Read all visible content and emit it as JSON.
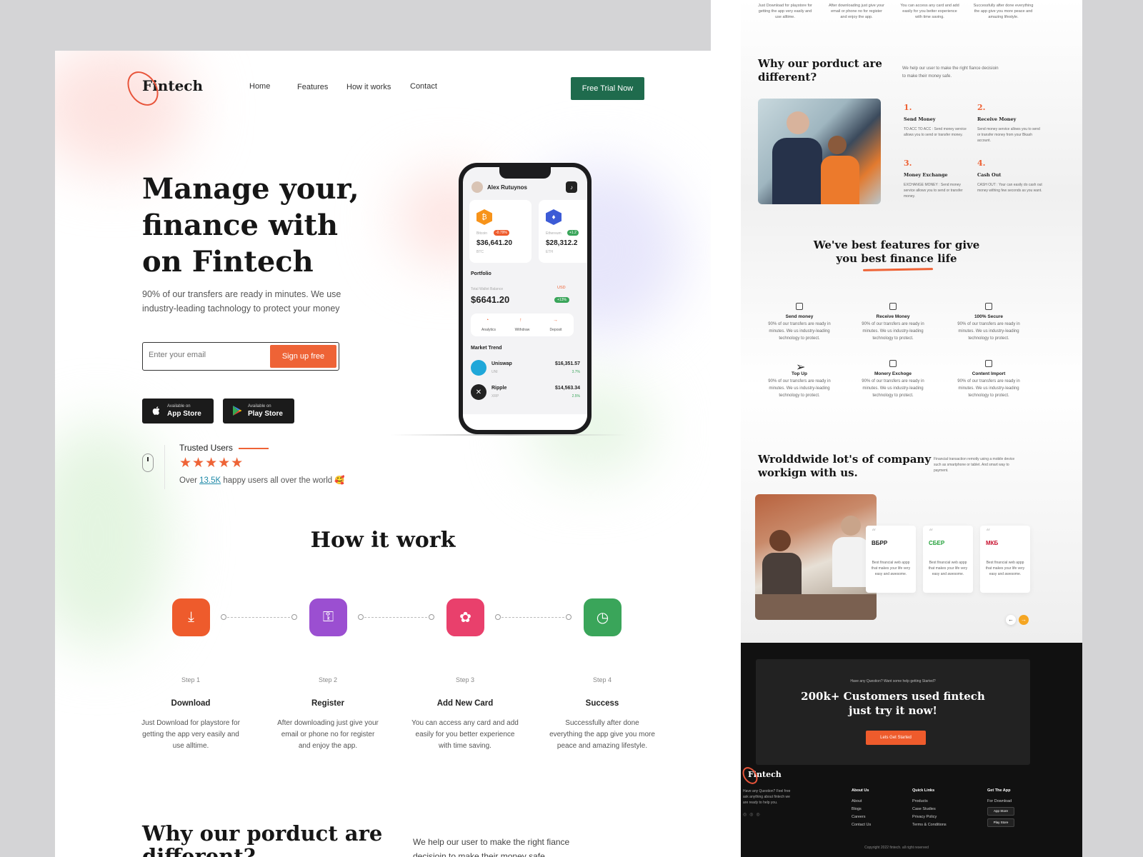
{
  "brand": "Fintech",
  "nav": {
    "home": "Home",
    "features": "Features",
    "how": "How it works",
    "contact": "Contact",
    "cta": "Free Trial Now"
  },
  "hero": {
    "line1": "Manage your,",
    "line2": "finance with",
    "line3": "on Fintech",
    "subtitle": "90% of our transfers are ready in minutes. We use industry-leading tachnology to protect your money",
    "email_placeholder": "Enter your email",
    "signup": "Sign up free"
  },
  "stores": {
    "appstore_small": "Available on",
    "appstore": "App Store",
    "playstore_small": "Available on",
    "playstore": "Play Store"
  },
  "trusted": {
    "title": "Trusted Users",
    "stars": "★★★★★",
    "rating": 5,
    "prefix": "Over",
    "count": "13.5K",
    "suffix": "happy users all over the world 🥰"
  },
  "phone": {
    "user": "Alex Rutuynos",
    "coins": [
      {
        "name": "Bitcoin",
        "change": "-0.79%",
        "price": "$36,641.20",
        "sym": "BTC"
      },
      {
        "name": "Ethereum",
        "change": "+1.2",
        "price": "$28,312.2",
        "sym": "ETH"
      }
    ],
    "portfolio": "Portfolio",
    "balance_label": "Total Wallet Balance",
    "currency": "USD",
    "balance": "$6641.20",
    "balance_change": "+13%",
    "actions": [
      "Analytics",
      "Withdraw",
      "Deposit"
    ],
    "trend_title": "Market Trend",
    "trends": [
      {
        "name": "Uniswap",
        "sym": "UNI",
        "price": "$16,351.57",
        "change": "3.7%"
      },
      {
        "name": "Ripple",
        "sym": "XRP",
        "price": "$14,563.34",
        "change": "2.5%"
      }
    ]
  },
  "how": {
    "title": "How it work",
    "steps": [
      {
        "num": "Step 1",
        "title": "Download",
        "desc": "Just Download for playstore for getting the app very easily and use alltime.",
        "color": "#ee5b2c"
      },
      {
        "num": "Step 2",
        "title": "Register",
        "desc": "After downloading just give your email or phone no for register and enjoy the app.",
        "color": "#9b4fd1"
      },
      {
        "num": "Step 3",
        "title": "Add New Card",
        "desc": "You can access any card and add easily for you better experience with time saving.",
        "color": "#e9406c"
      },
      {
        "num": "Step 4",
        "title": "Success",
        "desc": "Successfully after done everything the app give you more peace and amazing lifestyle.",
        "color": "#3aa55a"
      }
    ]
  },
  "why": {
    "title1": "Why our porduct are",
    "title2": "different?",
    "subtitle": "We help our user to make the right fiance decisioin to make their money safe."
  },
  "right": {
    "top_steps": [
      "Just Download for playstore for getting the app very easily and use alltime.",
      "After downloading just give your email or phone no for register and enjoy the app.",
      "You can access any card and add easily for you better experience with time saving.",
      "Successfully after done everything the app give you more peace and amazing lifestyle."
    ],
    "why_title1": "Why our porduct are",
    "why_title2": "different?",
    "why_sub": "We help our user to make the right fiance decisioin to make their money safe.",
    "services": [
      {
        "num": "1.",
        "title": "Send Money",
        "desc": "TO ACC TO ACC : Send money service allows you to send or transfer money."
      },
      {
        "num": "2.",
        "title": "Receive Money",
        "desc": "Send money service allows you to send or transfer money from your Bkash account."
      },
      {
        "num": "3.",
        "title": "Money Exchange",
        "desc": "EXCHANGE MONEY : Send money service allows you to send or transfer money."
      },
      {
        "num": "4.",
        "title": "Cash Out",
        "desc": "CASH OUT : Your can easily do cash out money withing few seconds as you want."
      }
    ],
    "feat_title1": "We've best features for give",
    "feat_title2": "you best finance life",
    "features": [
      {
        "title": "Send money",
        "desc": "90% of our transfers are ready in minutes. We us industry-leading technology to protect."
      },
      {
        "title": "Receive Money",
        "desc": "90% of our transfers are ready in minutes. We us industry-leading technology to protect."
      },
      {
        "title": "100% Secure",
        "desc": "90% of our transfers are ready in minutes. We us industry-leading technology to protect."
      },
      {
        "title": "Top Up",
        "desc": "90% of our transfers are ready in minutes. We us industry-leading technology to protect."
      },
      {
        "title": "Monery Exchoge",
        "desc": "90% of our transfers are ready in minutes. We us industry-leading technology to protect."
      },
      {
        "title": "Content Import",
        "desc": "90% of our transfers are ready in minutes. We us industry-leading technology to protect."
      }
    ],
    "world_title1": "Wrolddwide lot's of company",
    "world_title2": "workign with us.",
    "world_sub": "Financial transaction remotly using a mobile device such as smartphone or tablet. And smart way to payment.",
    "testimonials": [
      {
        "brand": "ВБРР",
        "text": "Best financial web appp that makes your life very easy and awesome."
      },
      {
        "brand": "СБЕР",
        "text": "Best financial web appp that makes your life very easy and awesome."
      },
      {
        "brand": "МКБ",
        "text": "Best financial web appp that makes your life very easy and awesome."
      }
    ],
    "cta_small": "Have any Question? Want some help getting Started?",
    "cta_title1": "200k+ Customers used fintech",
    "cta_title2": "just try  it now!",
    "cta_button": "Lets Get Started",
    "footer_about": "Have any Question? Feel free ask anything about fintech we are ready to help you.",
    "footer_cols": [
      {
        "title": "About Us",
        "items": [
          "About",
          "Blogs",
          "Careers",
          "Contact Us"
        ]
      },
      {
        "title": "Quick Links",
        "items": [
          "Products",
          "Case Studies",
          "Privacy Policy",
          "Terms & Conditions"
        ]
      },
      {
        "title": "Get The App",
        "items": [
          "For Download"
        ]
      }
    ],
    "footer_store1": "App Store",
    "footer_store2": "Play Store",
    "copyright": "Copyright 2022 fintech. all right reserved"
  },
  "colors": {
    "accent": "#ee6336",
    "green": "#1f6b4d"
  }
}
